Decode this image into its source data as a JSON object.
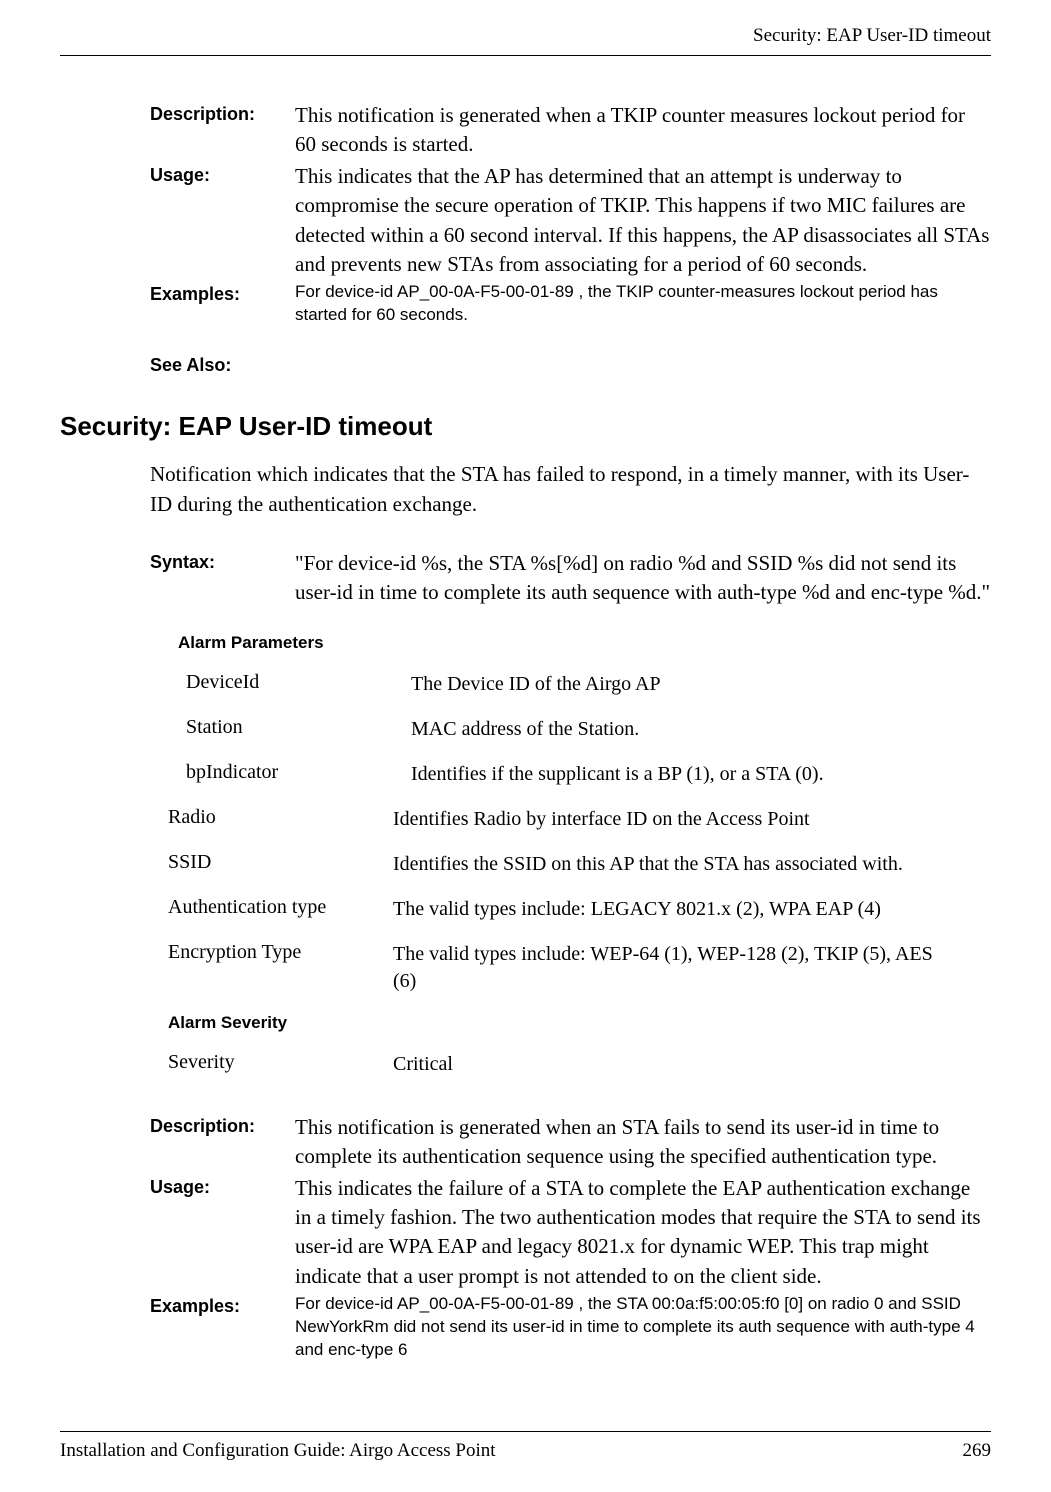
{
  "header": {
    "running_title": "Security: EAP User-ID timeout"
  },
  "block1": {
    "description_label": "Description:",
    "description_text": "This notification is generated when a TKIP counter measures lockout period for 60 seconds is started.",
    "usage_label": "Usage:",
    "usage_text": "This indicates that the AP has determined that an attempt is underway to compromise the secure operation of TKIP. This happens if two MIC failures are detected within a 60 second interval. If this happens, the AP disassociates all STAs and prevents new STAs from associating for a period of 60 seconds.",
    "examples_label": "Examples:",
    "examples_text": "For device-id AP_00-0A-F5-00-01-89 , the TKIP counter-measures lockout period has started for 60 seconds.",
    "see_also_label": "See Also:"
  },
  "section": {
    "heading": "Security: EAP User-ID timeout",
    "intro": "Notification which indicates that the STA has failed to respond, in a timely manner, with its User-ID during the authentication exchange.",
    "syntax_label": "Syntax:",
    "syntax_text": "\"For device-id %s, the STA %s[%d] on radio %d and SSID %s did not send its user-id in time to complete its auth sequence with auth-type %d and enc-type %d.\"",
    "alarm_params_heading": "Alarm Parameters",
    "params": [
      {
        "name": " DeviceId",
        "desc": "The Device ID of the Airgo AP"
      },
      {
        "name": " Station",
        "desc": "MAC address of the Station."
      },
      {
        "name": " bpIndicator",
        "desc": "Identifies if the supplicant is a BP (1), or a STA (0)."
      },
      {
        "name": "Radio",
        "desc": "Identifies Radio by interface ID on the Access Point"
      },
      {
        "name": "SSID",
        "desc": "Identifies the SSID on this AP that the STA has associated with."
      },
      {
        "name": "Authentication type",
        "desc": "The valid types include: LEGACY 8021.x (2), WPA EAP (4)"
      },
      {
        "name": "Encryption Type",
        "desc": "The valid types include:  WEP-64 (1), WEP-128 (2), TKIP (5), AES  (6)"
      }
    ],
    "alarm_severity_heading": "Alarm Severity",
    "severity_name": "Severity",
    "severity_value": "Critical"
  },
  "block2": {
    "description_label": "Description:",
    "description_text": "This notification is generated when an STA fails to send its user-id in time to complete its authentication sequence using the specified authentication type.",
    "usage_label": "Usage:",
    "usage_text": "This indicates the failure of a STA to complete the EAP authentication exchange in a timely fashion. The two authentication modes that require the STA to send its user-id are WPA EAP and legacy 8021.x for dynamic WEP. This trap might indicate that a user prompt is not attended to on the client side.",
    "examples_label": "Examples:",
    "examples_text": "For device-id AP_00-0A-F5-00-01-89 , the STA 00:0a:f5:00:05:f0 [0] on radio 0 and SSID NewYorkRm did not send its user-id in time to complete its auth sequence with auth-type 4 and enc-type 6"
  },
  "footer": {
    "left": "Installation and Configuration Guide: Airgo Access Point",
    "right": "269"
  }
}
